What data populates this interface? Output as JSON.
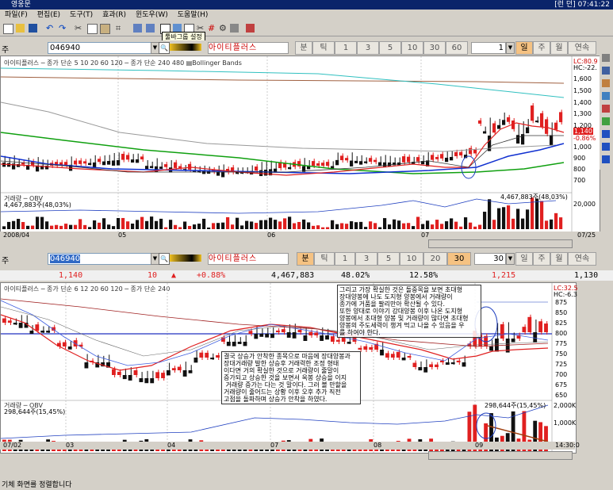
{
  "window": {
    "title": "영웅문",
    "right_text": "[런 던] 07:41:22"
  },
  "menu": [
    "파일(F)",
    "편집(E)",
    "도구(T)",
    "효과(R)",
    "윈도우(W)",
    "도움말(H)"
  ],
  "tooltip": "툴바그룹 설정",
  "top": {
    "code_label": "주",
    "code": "046940",
    "name": "아이티플러스",
    "periods": [
      "분",
      "틱",
      "1",
      "3",
      "5",
      "10",
      "30",
      "60"
    ],
    "count": "1",
    "ranges": [
      "일",
      "주",
      "월",
      "연속"
    ],
    "active_range": "일",
    "legend": "아이티플러스 ─ 종가 단순 5  10  20  60  120 ─ 종가 단순 240  480 ▤Bollinger Bands",
    "yaxis": [
      "1,600",
      "1,500",
      "1,400",
      "1,300",
      "1,200",
      "1,100",
      "1,000",
      "900",
      "800",
      "700"
    ],
    "right_labels": [
      "LC:80.9",
      "HC:-22.",
      "1,140",
      "-0.86%"
    ],
    "vol_legend": "거래량 ─ OBV",
    "vol_value": "4,467,883주(48,03%)",
    "vol_value_right": "4,467,883주(48,03%)",
    "vol_axis": "20,000",
    "xaxis": [
      "2008/04",
      "05",
      "06",
      "07",
      "07/25"
    ]
  },
  "bottom": {
    "code_label": "주",
    "code": "046940",
    "name": "아이티플러스",
    "periods": [
      "분",
      "틱",
      "1",
      "3",
      "5",
      "10",
      "20",
      "30"
    ],
    "count": "30",
    "ranges": [
      "일",
      "주",
      "월",
      "연속"
    ],
    "active_period": "30",
    "info": {
      "price": "1,140",
      "change": "10",
      "change_dir": "▲",
      "pct": "+0.88%",
      "volume": "4,467,883",
      "vol_pct": "48.02%",
      "turnover": "12.58%",
      "prev": "1,215",
      "last": "1,130"
    },
    "legend": "아이티플러스 ─ 종가 단순 6  12  20  60  120 ─ 종가 단순 240",
    "yaxis": [
      "875",
      "850",
      "825",
      "800",
      "775",
      "750",
      "725",
      "700",
      "675",
      "650"
    ],
    "right_labels": [
      "LC:32.5",
      "HC:-6.3"
    ],
    "vol_legend": "거래량 ─ OBV",
    "vol_value": "298,644주(15,45%)",
    "vol_value_right": "298,644주(15,45%)",
    "vol_axis": [
      "2,000K",
      "1,000K"
    ],
    "xaxis": [
      "07/02",
      "03",
      "04",
      "07",
      "08",
      "09",
      "14:30:0"
    ]
  },
  "notes": {
    "right": "그리고 가장 확실한 것은 돌중목을 보면 초대형\n장대양봉에 나도 도지형 양봉에서 거래량이\n종가에 거품을 팔리만아 확산될 수 있다.\n또한 양대로 이야기 강대양봉 이후 나온 도지형\n양봉에서 초대형 양봉 및 거래량이 많다면 초대형\n양봉의 주도세력이 챙겨 먹고 나올 수 있음을 우\n를 하여야 한다.",
    "left": "결국 상승가 안착한 종목으로 마음에 장대양봉과\n장대거래량 발한 상승후 거래력한 조정 형태\n이다면 거의 확실한 것으로 거래량이 줄말이\n증가되고 상승한 것을 보면서 옥봉 상승을 이지\n 거래량 증가는 다는 것 말이다. 그러 볼 만할을\n거래량이 줄어드는 상황 이후 오후 추가 직전\n고점을 돌파하며 상승가 안착을 하였다."
  },
  "status": "기체 화면를 정렬합니다"
}
